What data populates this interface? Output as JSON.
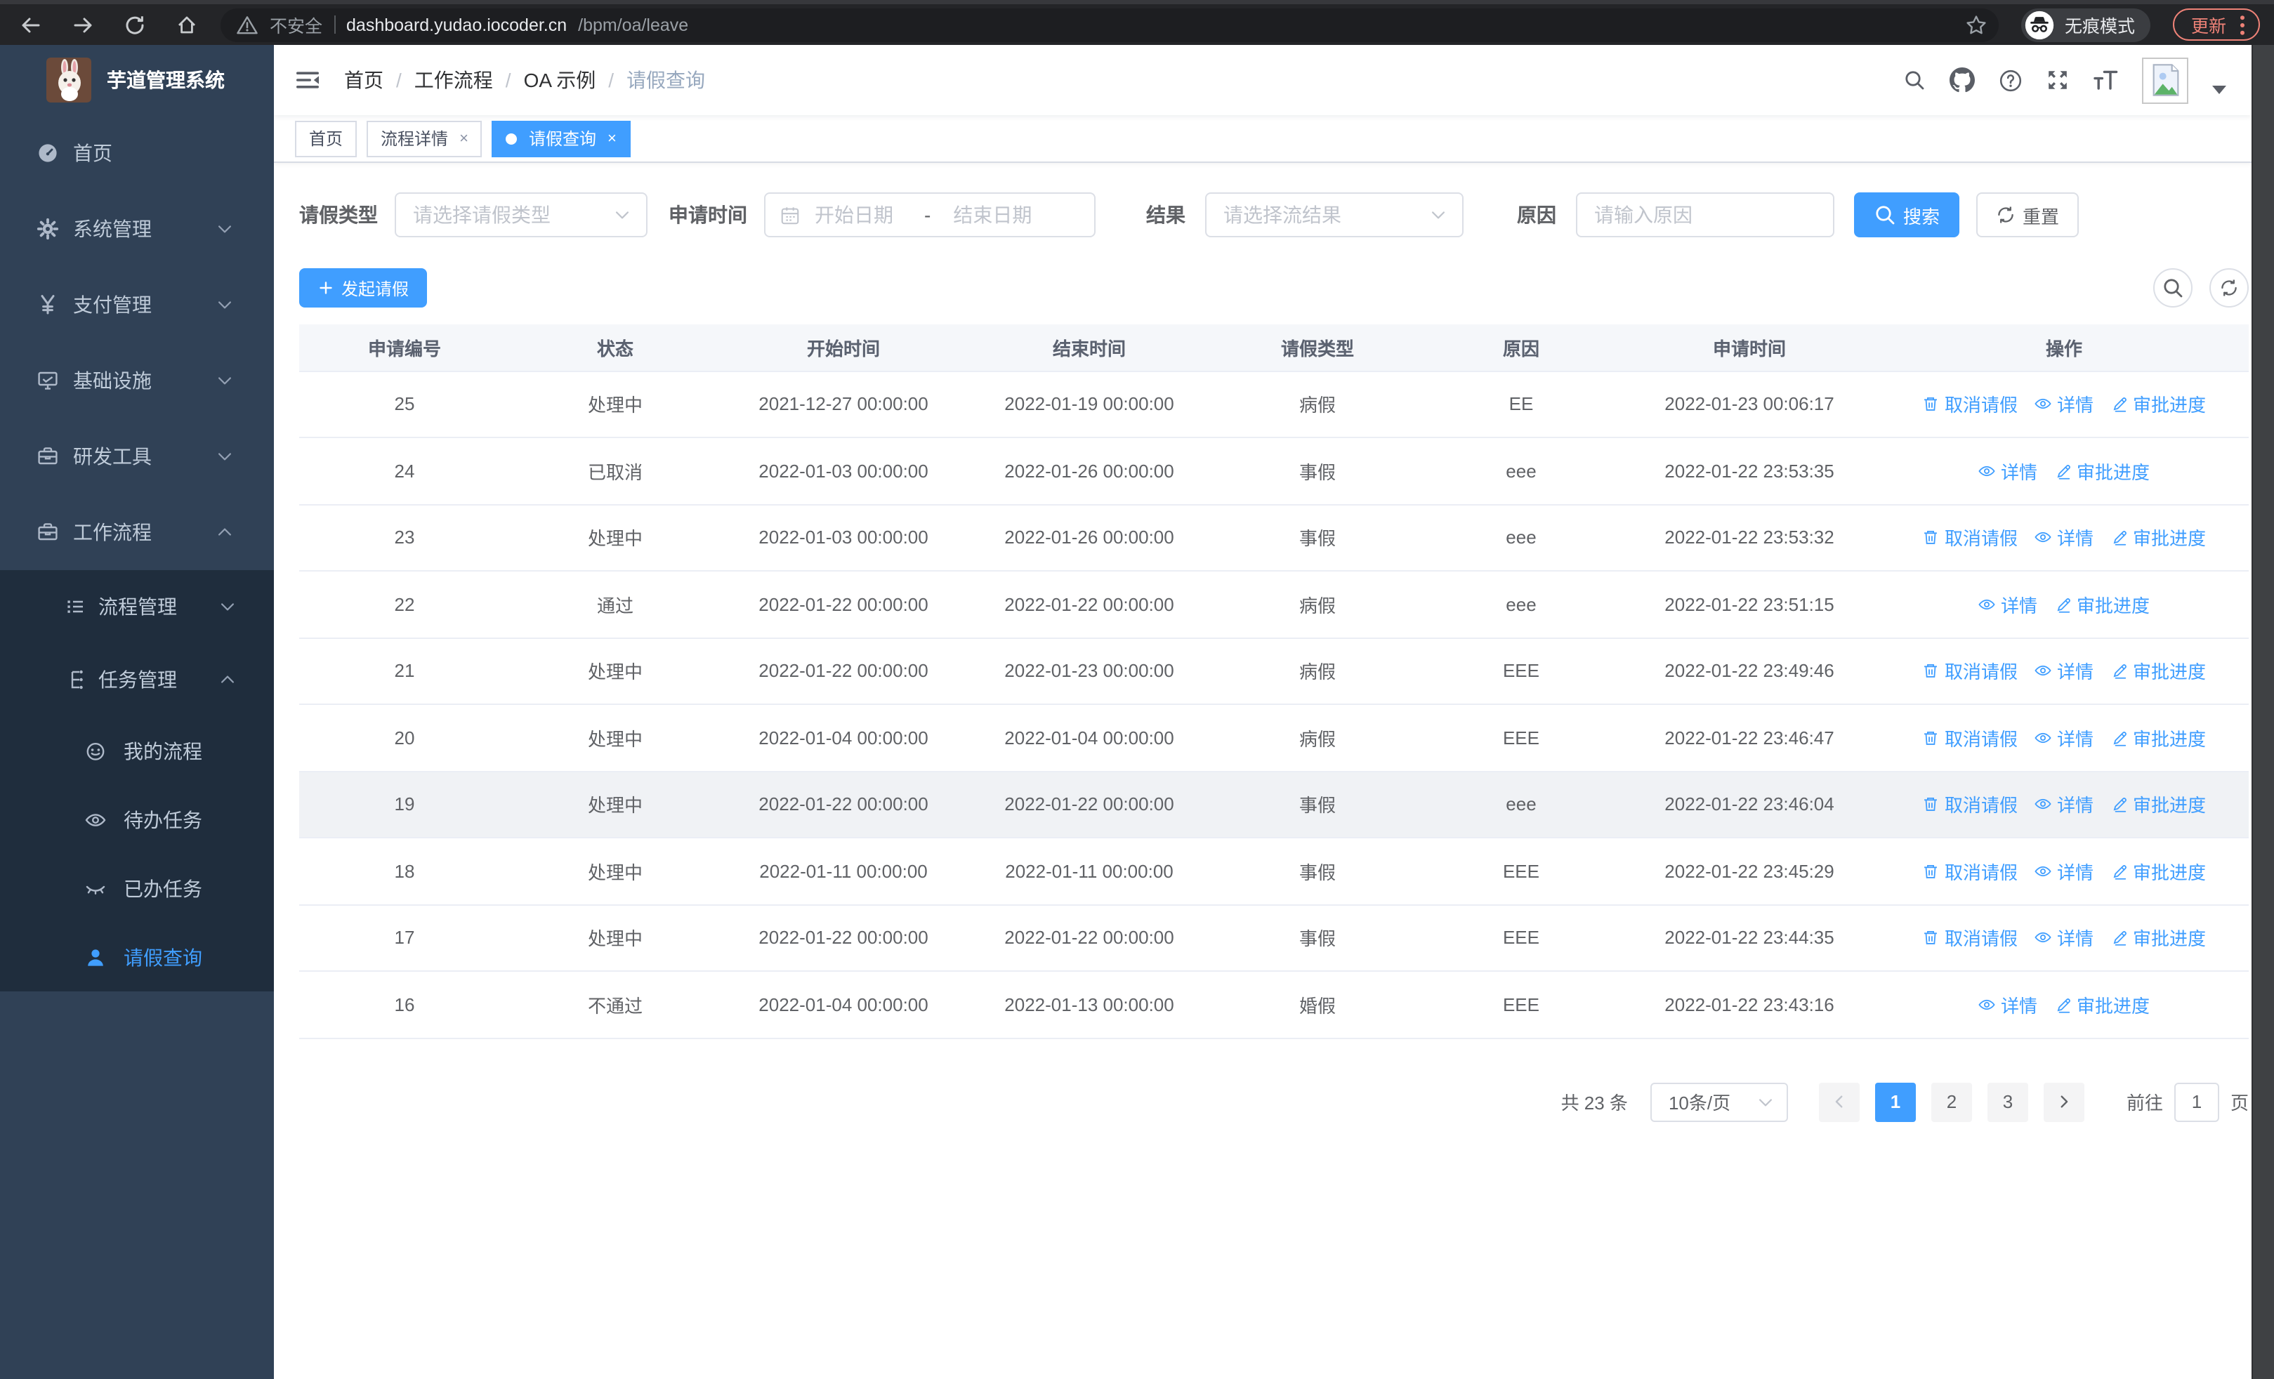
{
  "browser": {
    "security": "不安全",
    "host": "dashboard.yudao.iocoder.cn",
    "path": "/bpm/oa/leave",
    "incognito": "无痕模式",
    "update": "更新"
  },
  "sidebar": {
    "title": "芋道管理系统",
    "menu": [
      {
        "label": "首页",
        "icon": "dashboard-icon",
        "level": 1,
        "arrow": "none",
        "dark": false,
        "active": false
      },
      {
        "label": "系统管理",
        "icon": "gear-icon",
        "level": 1,
        "arrow": "down",
        "dark": false,
        "active": false
      },
      {
        "label": "支付管理",
        "icon": "yen-icon",
        "level": 1,
        "arrow": "down",
        "dark": false,
        "active": false
      },
      {
        "label": "基础设施",
        "icon": "monitor-icon",
        "level": 1,
        "arrow": "down",
        "dark": false,
        "active": false
      },
      {
        "label": "研发工具",
        "icon": "toolbox-icon",
        "level": 1,
        "arrow": "down",
        "dark": false,
        "active": false
      },
      {
        "label": "工作流程",
        "icon": "briefcase-icon",
        "level": 1,
        "arrow": "up",
        "dark": false,
        "active": false
      },
      {
        "label": "流程管理",
        "icon": "flow-list-icon",
        "level": 2,
        "arrow": "down",
        "dark": true,
        "active": false
      },
      {
        "label": "任务管理",
        "icon": "org-tree-icon",
        "level": 2,
        "arrow": "up",
        "dark": true,
        "active": false
      },
      {
        "label": "我的流程",
        "icon": "robot-face-icon",
        "level": 3,
        "arrow": "none",
        "dark": true,
        "active": false
      },
      {
        "label": "待办任务",
        "icon": "eye-open-icon",
        "level": 3,
        "arrow": "none",
        "dark": true,
        "active": false
      },
      {
        "label": "已办任务",
        "icon": "eye-closed-icon",
        "level": 3,
        "arrow": "none",
        "dark": true,
        "active": false
      },
      {
        "label": "请假查询",
        "icon": "user-icon",
        "level": 3,
        "arrow": "none",
        "dark": true,
        "active": true
      }
    ]
  },
  "navbar": {
    "breadcrumb": [
      {
        "label": "首页",
        "current": false
      },
      {
        "label": "工作流程",
        "current": false
      },
      {
        "label": "OA 示例",
        "current": false
      },
      {
        "label": "请假查询",
        "current": true
      }
    ]
  },
  "tabs": [
    {
      "label": "首页",
      "closable": false,
      "active": false
    },
    {
      "label": "流程详情",
      "closable": true,
      "active": false
    },
    {
      "label": "请假查询",
      "closable": true,
      "active": true
    }
  ],
  "filters": {
    "type_label": "请假类型",
    "type_placeholder": "请选择请假类型",
    "time_label": "申请时间",
    "date_start_placeholder": "开始日期",
    "date_separator": "-",
    "date_end_placeholder": "结束日期",
    "result_label": "结果",
    "result_placeholder": "请选择流结果",
    "reason_label": "原因",
    "reason_placeholder": "请输入原因",
    "search_label": "搜索",
    "reset_label": "重置"
  },
  "toolbar": {
    "create_label": "发起请假"
  },
  "table": {
    "headers": [
      "申请编号",
      "状态",
      "开始时间",
      "结束时间",
      "请假类型",
      "原因",
      "申请时间",
      "操作"
    ],
    "action_labels": {
      "cancel": "取消请假",
      "detail": "详情",
      "progress": "审批进度"
    },
    "rows": [
      {
        "id": "25",
        "status": "处理中",
        "start": "2021-12-27 00:00:00",
        "end": "2022-01-19 00:00:00",
        "type": "病假",
        "reason": "EE",
        "apply_time": "2022-01-23 00:06:17",
        "actions": [
          "cancel",
          "detail",
          "progress"
        ],
        "highlight": false
      },
      {
        "id": "24",
        "status": "已取消",
        "start": "2022-01-03 00:00:00",
        "end": "2022-01-26 00:00:00",
        "type": "事假",
        "reason": "eee",
        "apply_time": "2022-01-22 23:53:35",
        "actions": [
          "detail",
          "progress"
        ],
        "highlight": false
      },
      {
        "id": "23",
        "status": "处理中",
        "start": "2022-01-03 00:00:00",
        "end": "2022-01-26 00:00:00",
        "type": "事假",
        "reason": "eee",
        "apply_time": "2022-01-22 23:53:32",
        "actions": [
          "cancel",
          "detail",
          "progress"
        ],
        "highlight": false
      },
      {
        "id": "22",
        "status": "通过",
        "start": "2022-01-22 00:00:00",
        "end": "2022-01-22 00:00:00",
        "type": "病假",
        "reason": "eee",
        "apply_time": "2022-01-22 23:51:15",
        "actions": [
          "detail",
          "progress"
        ],
        "highlight": false
      },
      {
        "id": "21",
        "status": "处理中",
        "start": "2022-01-22 00:00:00",
        "end": "2022-01-23 00:00:00",
        "type": "病假",
        "reason": "EEE",
        "apply_time": "2022-01-22 23:49:46",
        "actions": [
          "cancel",
          "detail",
          "progress"
        ],
        "highlight": false
      },
      {
        "id": "20",
        "status": "处理中",
        "start": "2022-01-04 00:00:00",
        "end": "2022-01-04 00:00:00",
        "type": "病假",
        "reason": "EEE",
        "apply_time": "2022-01-22 23:46:47",
        "actions": [
          "cancel",
          "detail",
          "progress"
        ],
        "highlight": false
      },
      {
        "id": "19",
        "status": "处理中",
        "start": "2022-01-22 00:00:00",
        "end": "2022-01-22 00:00:00",
        "type": "事假",
        "reason": "eee",
        "apply_time": "2022-01-22 23:46:04",
        "actions": [
          "cancel",
          "detail",
          "progress"
        ],
        "highlight": true
      },
      {
        "id": "18",
        "status": "处理中",
        "start": "2022-01-11 00:00:00",
        "end": "2022-01-11 00:00:00",
        "type": "事假",
        "reason": "EEE",
        "apply_time": "2022-01-22 23:45:29",
        "actions": [
          "cancel",
          "detail",
          "progress"
        ],
        "highlight": false
      },
      {
        "id": "17",
        "status": "处理中",
        "start": "2022-01-22 00:00:00",
        "end": "2022-01-22 00:00:00",
        "type": "事假",
        "reason": "EEE",
        "apply_time": "2022-01-22 23:44:35",
        "actions": [
          "cancel",
          "detail",
          "progress"
        ],
        "highlight": false
      },
      {
        "id": "16",
        "status": "不通过",
        "start": "2022-01-04 00:00:00",
        "end": "2022-01-13 00:00:00",
        "type": "婚假",
        "reason": "EEE",
        "apply_time": "2022-01-22 23:43:16",
        "actions": [
          "detail",
          "progress"
        ],
        "highlight": false
      }
    ]
  },
  "pagination": {
    "total_text": "共 23 条",
    "page_size": "10条/页",
    "pages": [
      "1",
      "2",
      "3"
    ],
    "active_page": "1",
    "goto_label": "前往",
    "goto_value": "1",
    "page_suffix": "页"
  },
  "colors": {
    "primary": "#409eff",
    "sidebar_bg": "#304156",
    "submenu_bg": "#1f2d3d",
    "update_accent": "#ee8277"
  }
}
